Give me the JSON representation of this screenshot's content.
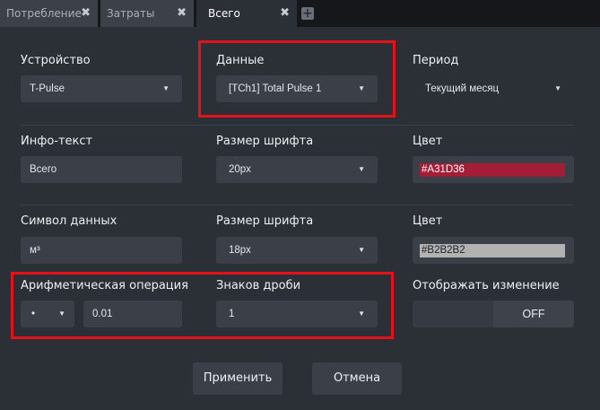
{
  "tabs": [
    {
      "label": "Потребление",
      "close": "✖"
    },
    {
      "label": "Затраты",
      "close": "✖"
    },
    {
      "label": "Всего",
      "close": "✖"
    }
  ],
  "add_tab": "+",
  "row1": {
    "device": {
      "label": "Устройство",
      "value": "T-Pulse"
    },
    "data": {
      "label": "Данные",
      "value": "[TCh1] Total Pulse 1"
    },
    "period": {
      "label": "Период",
      "value": "Текущий месяц"
    }
  },
  "row2": {
    "info": {
      "label": "Инфо-текст",
      "value": "Всего"
    },
    "font": {
      "label": "Размер шрифта",
      "value": "20px"
    },
    "color": {
      "label": "Цвет",
      "value": "#A31D36"
    }
  },
  "row3": {
    "symbol": {
      "label": "Символ данных",
      "value": "м³"
    },
    "font": {
      "label": "Размер шрифта",
      "value": "18px"
    },
    "color": {
      "label": "Цвет",
      "value": "#B2B2B2"
    }
  },
  "row4": {
    "arith": {
      "label": "Арифметическая операция",
      "operator": "•",
      "value": "0.01"
    },
    "decimals": {
      "label": "Знаков дроби",
      "value": "1"
    },
    "show_change": {
      "label": "Отображать изменение",
      "state": "OFF"
    }
  },
  "caret": "▼",
  "buttons": {
    "apply": "Применить",
    "cancel": "Отмена"
  },
  "colors": {
    "highlight": "#E3121B",
    "swatch1": "#A31D36",
    "swatch2": "#B2B2B2"
  }
}
